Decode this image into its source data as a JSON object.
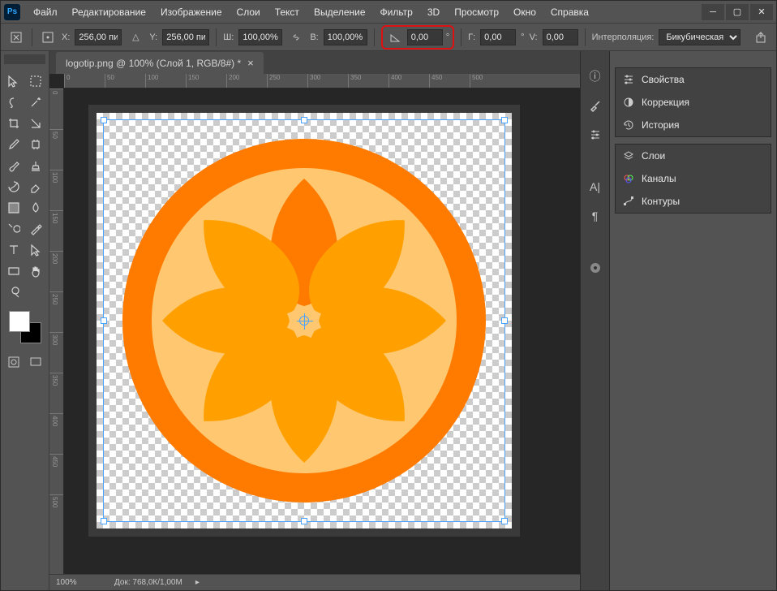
{
  "menu": [
    "Файл",
    "Редактирование",
    "Изображение",
    "Слои",
    "Текст",
    "Выделение",
    "Фильтр",
    "3D",
    "Просмотр",
    "Окно",
    "Справка"
  ],
  "options": {
    "x_label": "X:",
    "x_value": "256,00 пи",
    "y_label": "Y:",
    "y_value": "256,00 пи",
    "w_label": "Ш:",
    "w_value": "100,00%",
    "h_label": "В:",
    "h_value": "100,00%",
    "angle_value": "0,00",
    "angle_unit": "°",
    "sk_h_label": "Г:",
    "sk_h_value": "0,00",
    "sk_v_label": "V:",
    "sk_v_value": "0,00",
    "interp_label": "Интерполяция:",
    "interp_value": "Бикубическая"
  },
  "doc": {
    "tab": "logotip.png @ 100% (Слой 1, RGB/8#) *",
    "zoom": "100%",
    "docsize": "Док: 768,0К/1,00М"
  },
  "ruler_h": [
    "0",
    "50",
    "100",
    "150",
    "200",
    "250",
    "300",
    "350",
    "400",
    "450",
    "500"
  ],
  "ruler_v": [
    "0",
    "50",
    "100",
    "150",
    "200",
    "250",
    "300",
    "350",
    "400",
    "450",
    "500"
  ],
  "panels": {
    "group1": [
      {
        "icon": "sliders",
        "label": "Свойства"
      },
      {
        "icon": "half-circle",
        "label": "Коррекция"
      },
      {
        "icon": "history",
        "label": "История"
      }
    ],
    "group2": [
      {
        "icon": "layers",
        "label": "Слои"
      },
      {
        "icon": "channels",
        "label": "Каналы"
      },
      {
        "icon": "paths",
        "label": "Контуры"
      }
    ]
  },
  "tools": {
    "rows": [
      [
        "move",
        "marquee"
      ],
      [
        "lasso",
        "magic-wand"
      ],
      [
        "crop",
        "slice"
      ],
      [
        "eyedropper",
        "patch"
      ],
      [
        "brush",
        "stamp"
      ],
      [
        "history-brush",
        "eraser"
      ],
      [
        "gradient",
        "blur"
      ],
      [
        "dodge",
        "pen"
      ],
      [
        "type",
        "path-select"
      ],
      [
        "shape",
        "hand"
      ],
      [
        "zoom",
        ""
      ]
    ]
  }
}
